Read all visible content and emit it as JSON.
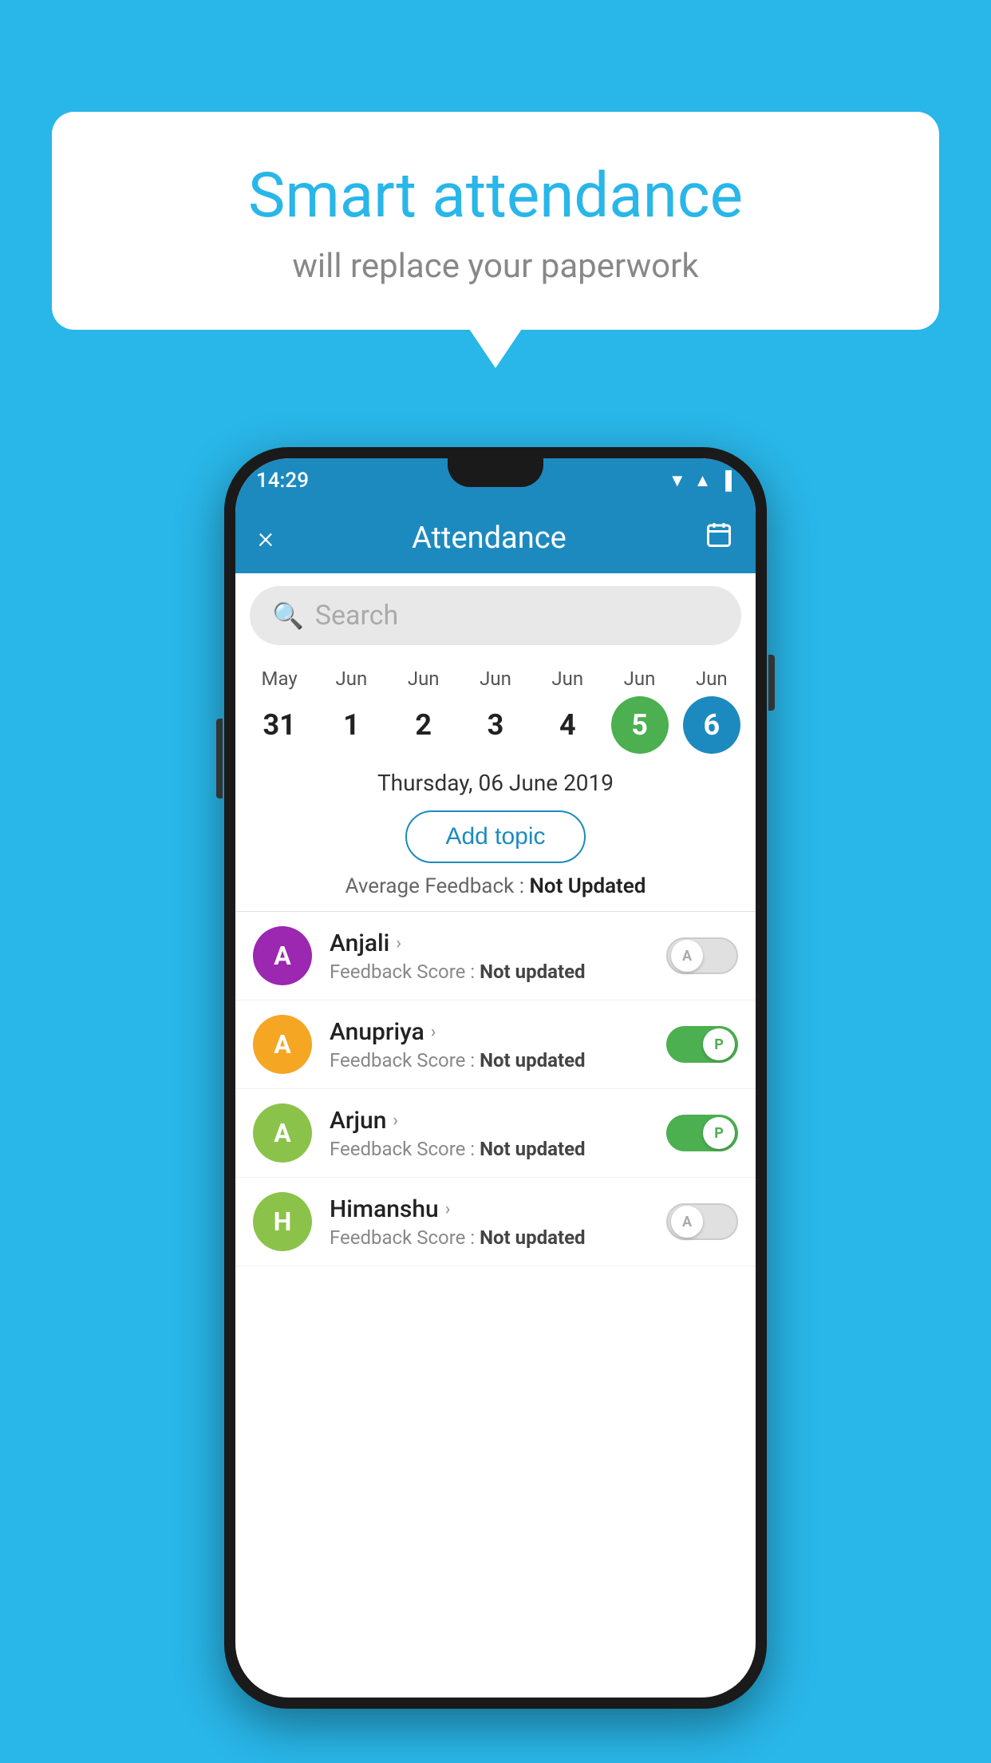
{
  "page": {
    "background_color": "#29b6e8"
  },
  "bubble": {
    "title": "Smart attendance",
    "subtitle": "will replace your paperwork"
  },
  "status_bar": {
    "time": "14:29"
  },
  "header": {
    "close_label": "×",
    "title": "Attendance",
    "calendar_icon": "📅"
  },
  "search": {
    "placeholder": "Search"
  },
  "calendar": {
    "days": [
      {
        "month": "May",
        "date": "31",
        "state": "normal"
      },
      {
        "month": "Jun",
        "date": "1",
        "state": "normal"
      },
      {
        "month": "Jun",
        "date": "2",
        "state": "normal"
      },
      {
        "month": "Jun",
        "date": "3",
        "state": "normal"
      },
      {
        "month": "Jun",
        "date": "4",
        "state": "normal"
      },
      {
        "month": "Jun",
        "date": "5",
        "state": "today"
      },
      {
        "month": "Jun",
        "date": "6",
        "state": "selected"
      }
    ]
  },
  "selected_date": "Thursday, 06 June 2019",
  "add_topic_label": "Add topic",
  "avg_feedback_label": "Average Feedback :",
  "avg_feedback_value": "Not Updated",
  "students": [
    {
      "name": "Anjali",
      "avatar_letter": "A",
      "avatar_color": "#9c27b0",
      "score_label": "Feedback Score :",
      "score_value": "Not updated",
      "toggle": "off",
      "toggle_letter": "A"
    },
    {
      "name": "Anupriya",
      "avatar_letter": "A",
      "avatar_color": "#f5a623",
      "score_label": "Feedback Score :",
      "score_value": "Not updated",
      "toggle": "on",
      "toggle_letter": "P"
    },
    {
      "name": "Arjun",
      "avatar_letter": "A",
      "avatar_color": "#8bc34a",
      "score_label": "Feedback Score :",
      "score_value": "Not updated",
      "toggle": "on",
      "toggle_letter": "P"
    },
    {
      "name": "Himanshu",
      "avatar_letter": "H",
      "avatar_color": "#8bc34a",
      "score_label": "Feedback Score :",
      "score_value": "Not updated",
      "toggle": "off",
      "toggle_letter": "A"
    }
  ]
}
